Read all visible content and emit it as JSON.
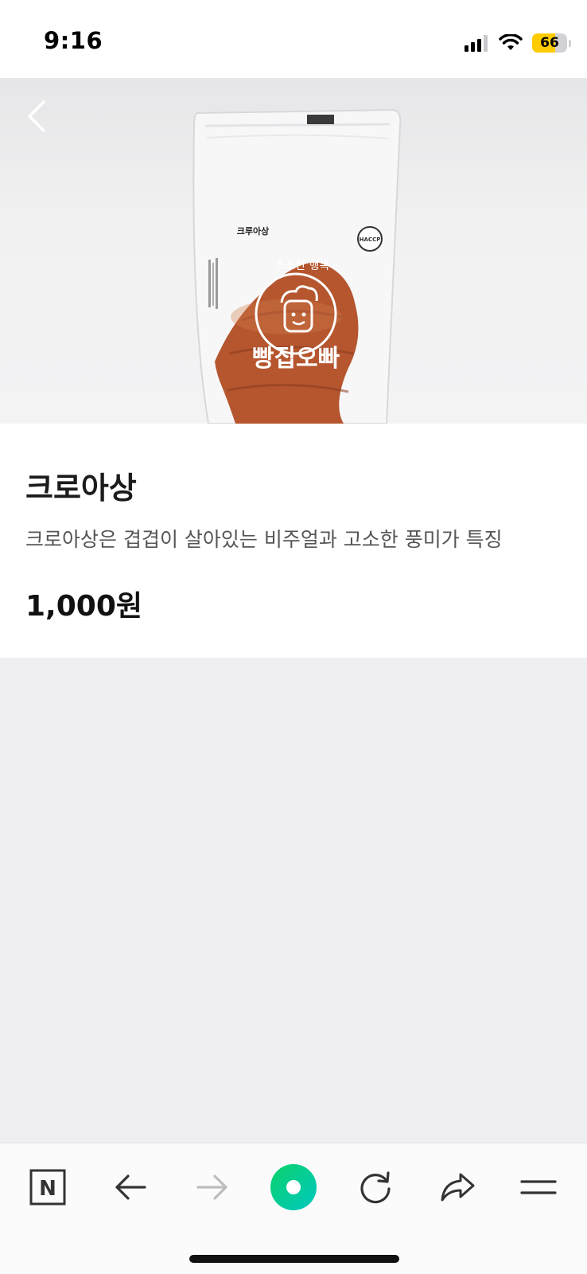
{
  "status_bar": {
    "time": "9:16",
    "battery_level": "66",
    "battery_color": "#ffcc00",
    "signal_bars_active": 3,
    "signal_bars_total": 4
  },
  "hero": {
    "package_label": "크루아상",
    "logo_arc_text": "소소한 행복",
    "brand_text": "빵집오빠",
    "badge_text": "HACCP",
    "back_icon": "chevron-left-icon"
  },
  "product": {
    "name": "크로아상",
    "description": "크로아상은 겹겹이 살아있는 비주얼과 고소한 풍미가 특징",
    "price": "1,000원"
  },
  "toolbar": {
    "items": [
      {
        "name": "naver-home-icon",
        "label": "N"
      },
      {
        "name": "arrow-left-icon"
      },
      {
        "name": "arrow-right-icon",
        "disabled": true
      },
      {
        "name": "green-dot-icon"
      },
      {
        "name": "refresh-icon"
      },
      {
        "name": "share-icon"
      },
      {
        "name": "menu-icon"
      }
    ],
    "accent_color": "#03c75a"
  }
}
